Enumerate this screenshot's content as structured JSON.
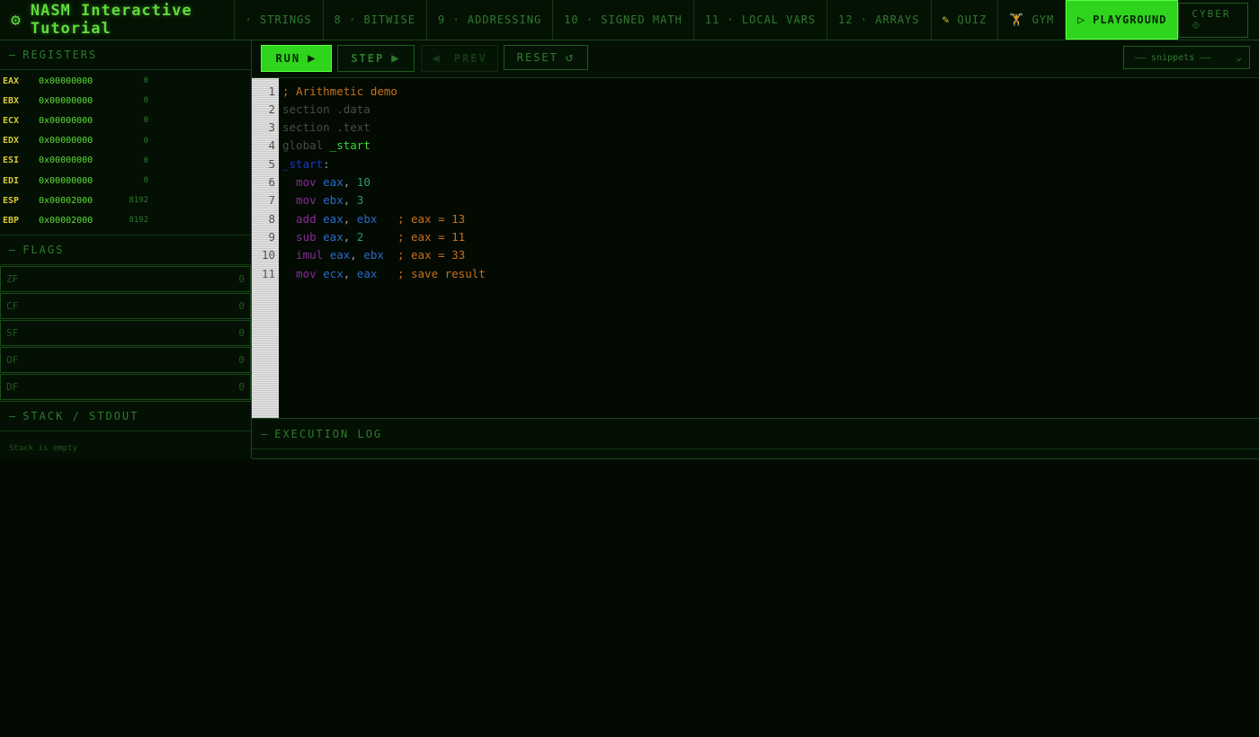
{
  "app": {
    "title": "NASM Interactive Tutorial",
    "logo_icon": "gear-icon",
    "accent": "#2ed51c"
  },
  "nav": {
    "tabs": [
      {
        "label": "· STRINGS"
      },
      {
        "label": "8 · BITWISE"
      },
      {
        "label": "9 · ADDRESSING"
      },
      {
        "label": "10 · SIGNED MATH"
      },
      {
        "label": "11 · LOCAL VARS"
      },
      {
        "label": "12 · ARRAYS"
      },
      {
        "label": "QUIZ",
        "icon": "pencil-icon"
      },
      {
        "label": "GYM",
        "icon": "dumbbell-icon"
      },
      {
        "label": "PLAYGROUND",
        "icon": "play-icon",
        "active": true
      }
    ],
    "theme_button": "CYBER ⟐"
  },
  "registers": {
    "title": "REGISTERS",
    "items": [
      {
        "name": "EAX",
        "hex": "0x00000000",
        "dec": "0"
      },
      {
        "name": "EBX",
        "hex": "0x00000000",
        "dec": "0"
      },
      {
        "name": "ECX",
        "hex": "0x00000000",
        "dec": "0"
      },
      {
        "name": "EDX",
        "hex": "0x00000000",
        "dec": "0"
      },
      {
        "name": "ESI",
        "hex": "0x00000000",
        "dec": "0"
      },
      {
        "name": "EDI",
        "hex": "0x00000000",
        "dec": "0"
      },
      {
        "name": "ESP",
        "hex": "0x00002000",
        "dec": "8192"
      },
      {
        "name": "EBP",
        "hex": "0x00002000",
        "dec": "8192"
      }
    ]
  },
  "flags": {
    "title": "FLAGS",
    "items": [
      {
        "name": "ZF",
        "value": "0"
      },
      {
        "name": "CF",
        "value": "0"
      },
      {
        "name": "SF",
        "value": "0"
      },
      {
        "name": "OF",
        "value": "0"
      },
      {
        "name": "DF",
        "value": "0"
      }
    ]
  },
  "stack": {
    "title": "STACK / STDOUT",
    "empty_text": "Stack is empty"
  },
  "toolbar": {
    "run_label": "RUN",
    "step_label": "STEP",
    "prev_label": "PREV",
    "reset_label": "RESET",
    "snippets_placeholder": "—— snippets ——"
  },
  "editor": {
    "lines": [
      {
        "n": "1",
        "tokens": [
          {
            "t": "; Arithmetic demo",
            "c": "comment"
          }
        ]
      },
      {
        "n": "2",
        "tokens": [
          {
            "t": "section .data",
            "c": "dir"
          }
        ]
      },
      {
        "n": "3",
        "tokens": [
          {
            "t": "section .text",
            "c": "dir"
          }
        ]
      },
      {
        "n": "4",
        "tokens": [
          {
            "t": "global ",
            "c": "dir"
          },
          {
            "t": "_start",
            "c": "glob"
          }
        ]
      },
      {
        "n": "5",
        "tokens": [
          {
            "t": "_start",
            "c": "label"
          },
          {
            "t": ":",
            "c": "punc"
          }
        ]
      },
      {
        "n": "6",
        "tokens": [
          {
            "t": "  mov ",
            "c": "kw"
          },
          {
            "t": "eax",
            "c": "reg"
          },
          {
            "t": ", ",
            "c": "punc"
          },
          {
            "t": "10",
            "c": "num"
          }
        ]
      },
      {
        "n": "7",
        "tokens": [
          {
            "t": "  mov ",
            "c": "kw"
          },
          {
            "t": "ebx",
            "c": "reg"
          },
          {
            "t": ", ",
            "c": "punc"
          },
          {
            "t": "3",
            "c": "num"
          }
        ]
      },
      {
        "n": "8",
        "tokens": [
          {
            "t": "  add ",
            "c": "kw"
          },
          {
            "t": "eax",
            "c": "reg"
          },
          {
            "t": ", ",
            "c": "punc"
          },
          {
            "t": "ebx",
            "c": "reg"
          },
          {
            "t": "   ; eax = 13",
            "c": "comment"
          }
        ]
      },
      {
        "n": "9",
        "tokens": [
          {
            "t": "  sub ",
            "c": "kw"
          },
          {
            "t": "eax",
            "c": "reg"
          },
          {
            "t": ", ",
            "c": "punc"
          },
          {
            "t": "2",
            "c": "num"
          },
          {
            "t": "     ; eax = 11",
            "c": "comment"
          }
        ]
      },
      {
        "n": "10",
        "tokens": [
          {
            "t": "  imul ",
            "c": "kw"
          },
          {
            "t": "eax",
            "c": "reg"
          },
          {
            "t": ", ",
            "c": "punc"
          },
          {
            "t": "ebx",
            "c": "reg"
          },
          {
            "t": "  ; eax = 33",
            "c": "comment"
          }
        ]
      },
      {
        "n": "11",
        "tokens": [
          {
            "t": "  mov ",
            "c": "kw"
          },
          {
            "t": "ecx",
            "c": "reg"
          },
          {
            "t": ", ",
            "c": "punc"
          },
          {
            "t": "eax",
            "c": "reg"
          },
          {
            "t": "   ; save result",
            "c": "comment"
          }
        ]
      }
    ]
  },
  "log": {
    "title": "EXECUTION LOG"
  }
}
